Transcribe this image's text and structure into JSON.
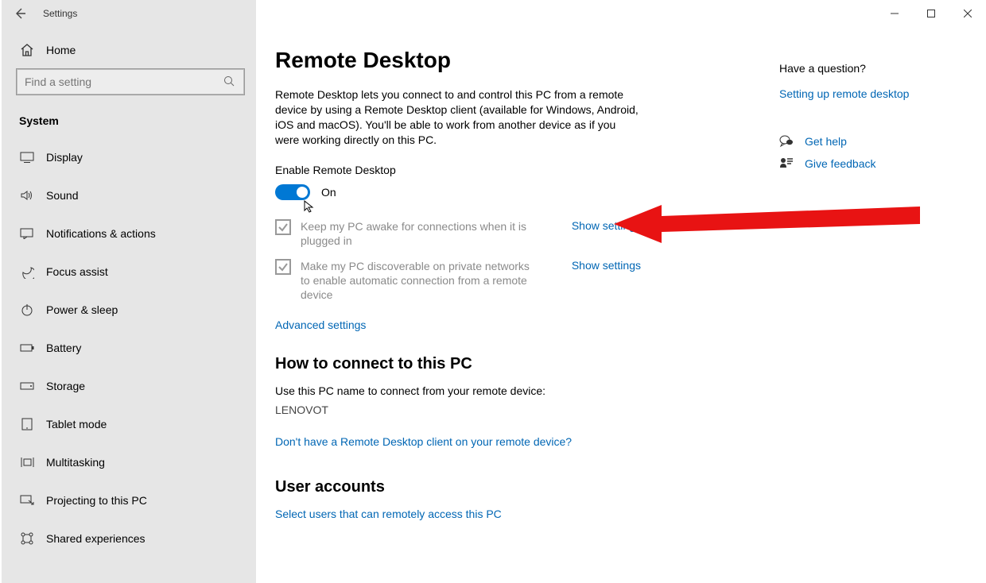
{
  "titlebar": {
    "title": "Settings"
  },
  "sidebar": {
    "home": "Home",
    "search_placeholder": "Find a setting",
    "category": "System",
    "items": [
      {
        "label": "Display"
      },
      {
        "label": "Sound"
      },
      {
        "label": "Notifications & actions"
      },
      {
        "label": "Focus assist"
      },
      {
        "label": "Power & sleep"
      },
      {
        "label": "Battery"
      },
      {
        "label": "Storage"
      },
      {
        "label": "Tablet mode"
      },
      {
        "label": "Multitasking"
      },
      {
        "label": "Projecting to this PC"
      },
      {
        "label": "Shared experiences"
      }
    ]
  },
  "page": {
    "title": "Remote Desktop",
    "description": "Remote Desktop lets you connect to and control this PC from a remote device by using a Remote Desktop client (available for Windows, Android, iOS and macOS). You'll be able to work from another device as if you were working directly on this PC.",
    "enable_label": "Enable Remote Desktop",
    "toggle_state": "On",
    "check1": "Keep my PC awake for connections when it is plugged in",
    "check2": "Make my PC discoverable on private networks to enable automatic connection from a remote device",
    "show_settings": "Show settings",
    "advanced": "Advanced settings",
    "howto_title": "How to connect to this PC",
    "howto_text": "Use this PC name to connect from your remote device:",
    "pc_name": "LENOVOT",
    "client_link": "Don't have a Remote Desktop client on your remote device?",
    "user_accounts_title": "User accounts",
    "user_accounts_link": "Select users that can remotely access this PC"
  },
  "aside": {
    "question": "Have a question?",
    "setup_link": "Setting up remote desktop",
    "get_help": "Get help",
    "give_feedback": "Give feedback"
  }
}
